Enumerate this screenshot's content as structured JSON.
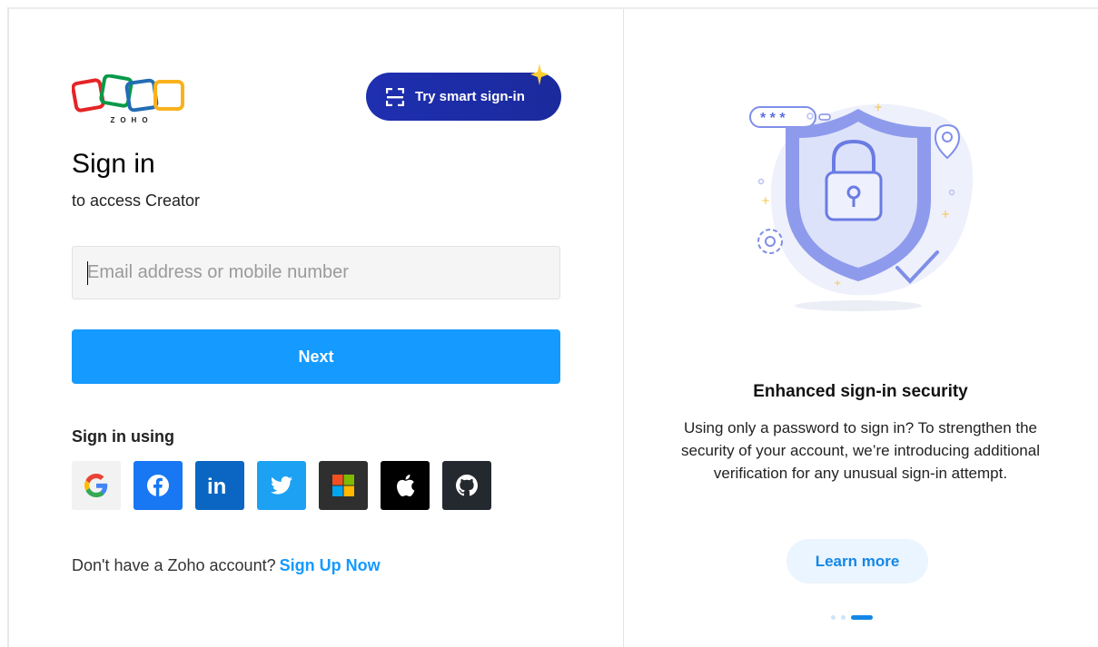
{
  "logo": {
    "text": "ZOHO"
  },
  "smart_signin": {
    "label": "Try smart sign-in",
    "icon": "qr-scan-icon"
  },
  "signin": {
    "title": "Sign in",
    "subtitle": "to access Creator",
    "email_placeholder": "Email address or mobile number",
    "email_value": "",
    "next_label": "Next"
  },
  "social": {
    "label": "Sign in using",
    "providers": [
      {
        "name": "Google",
        "icon": "google-icon",
        "bg": "#f2f2f2"
      },
      {
        "name": "Facebook",
        "icon": "facebook-icon",
        "bg": "#1877f2"
      },
      {
        "name": "LinkedIn",
        "icon": "linkedin-icon",
        "bg": "#0a66c2"
      },
      {
        "name": "Twitter",
        "icon": "twitter-icon",
        "bg": "#1da1f2"
      },
      {
        "name": "Microsoft",
        "icon": "microsoft-icon",
        "bg": "#2f2f2f"
      },
      {
        "name": "Apple",
        "icon": "apple-icon",
        "bg": "#000000"
      },
      {
        "name": "GitHub",
        "icon": "github-icon",
        "bg": "#24292f"
      }
    ]
  },
  "signup": {
    "prompt": "Don't have a Zoho account?",
    "link": "Sign Up Now"
  },
  "promo": {
    "title": "Enhanced sign-in security",
    "text": "Using only a password to sign in? To strengthen the security of your account, we’re introducing additional verification for any unusual sign-in attempt.",
    "button": "Learn more",
    "slides_total": 3,
    "active_slide": 3
  },
  "colors": {
    "primary": "#159aff",
    "smart_button": "#1b2a9c",
    "learn_more_bg": "#eaf5ff"
  }
}
